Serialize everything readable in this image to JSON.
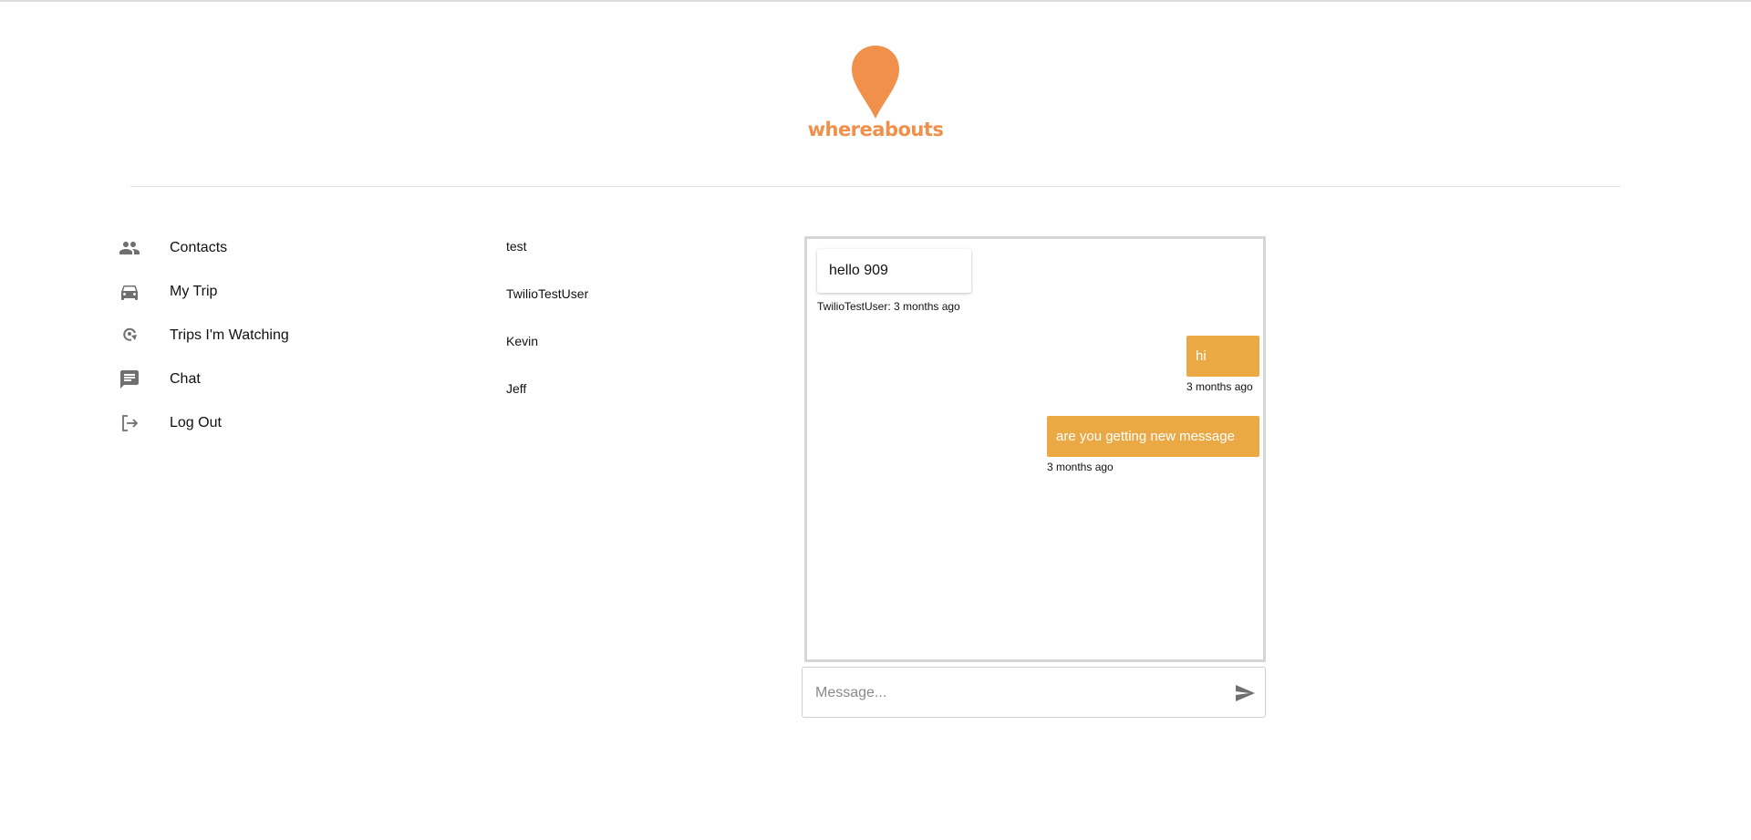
{
  "brand": {
    "name": "whereabouts",
    "color": "#f0904a",
    "icon": "map-pin-icon"
  },
  "nav": [
    {
      "label": "Contacts",
      "icon": "people-icon"
    },
    {
      "label": "My Trip",
      "icon": "car-icon"
    },
    {
      "label": "Trips I'm Watching",
      "icon": "location-refresh-icon"
    },
    {
      "label": "Chat",
      "icon": "chat-icon"
    },
    {
      "label": "Log Out",
      "icon": "logout-icon"
    }
  ],
  "contacts": [
    "test",
    "TwilioTestUser",
    "Kevin",
    "Jeff"
  ],
  "messages": [
    {
      "direction": "incoming",
      "text": "hello 909",
      "meta": "TwilioTestUser: 3 months ago"
    },
    {
      "direction": "outgoing",
      "text": "hi",
      "meta": "3 months ago"
    },
    {
      "direction": "outgoing",
      "text": "are you getting new message",
      "meta": "3 months ago"
    }
  ],
  "composer": {
    "placeholder": "Message...",
    "value": "",
    "send_icon": "send-icon"
  },
  "colors": {
    "accent": "#eba946",
    "icon_gray": "#6f6f6f"
  }
}
